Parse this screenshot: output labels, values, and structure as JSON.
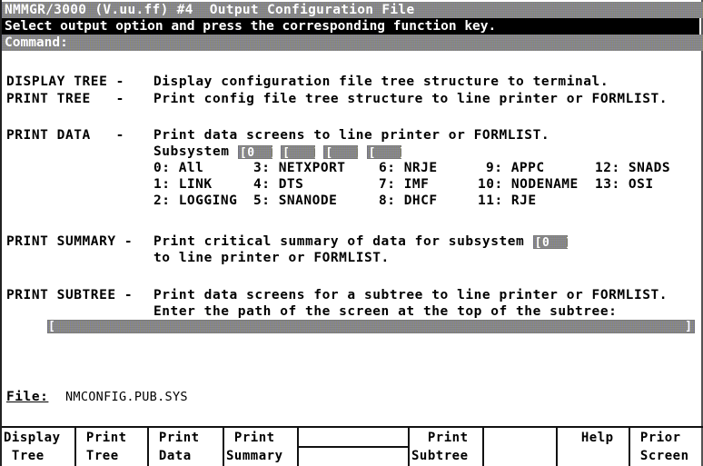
{
  "header": {
    "title": "NMMGR/3000 (V.uu.ff) #4  Output Configuration File",
    "message": "Select output option and press the corresponding function key.",
    "command_label": "Command:",
    "command_value": ""
  },
  "options": [
    {
      "label": "DISPLAY TREE -",
      "lines": [
        "Display configuration file tree structure to terminal."
      ]
    },
    {
      "label": "PRINT TREE   -",
      "lines": [
        "Print config file tree structure to line printer or FORMLIST."
      ]
    },
    {
      "label": "PRINT DATA   -",
      "lines": [
        "Print data screens to line printer or FORMLIST."
      ]
    },
    {
      "label": "PRINT SUMMARY -",
      "lines": [
        "Print critical summary of data for subsystem",
        "to line printer or FORMLIST."
      ]
    },
    {
      "label": "PRINT SUBTREE -",
      "lines": [
        "Print data screens for a subtree to line printer or FORMLIST.",
        "Enter the path of the screen at the top of the subtree:"
      ]
    }
  ],
  "print_data": {
    "subsystem_label": "Subsystem",
    "subsystem_fields": [
      "0",
      "",
      "",
      ""
    ],
    "subsystems": [
      [
        "0: All",
        "3: NETXPORT",
        "6: NRJE",
        "9: APPC",
        "12: SNADS"
      ],
      [
        "1: LINK",
        "4: DTS",
        "7: IMF",
        "10: NODENAME",
        "13: OSI"
      ],
      [
        "2: LOGGING",
        "5: SNANODE",
        "8: DHCF",
        "11: RJE",
        ""
      ]
    ]
  },
  "print_summary": {
    "subsystem_field": "0"
  },
  "print_subtree": {
    "path_value": ""
  },
  "file": {
    "label": "File:",
    "value": "NMCONFIG.PUB.SYS"
  },
  "function_keys": [
    {
      "line1": "Display",
      "line2": " Tree"
    },
    {
      "line1": " Print",
      "line2": " Tree"
    },
    {
      "line1": " Print",
      "line2": " Data"
    },
    {
      "line1": " Print",
      "line2": "Summary"
    },
    {
      "line1": "",
      "line2": ""
    },
    {
      "line1": "  Print",
      "line2": "Subtree"
    },
    {
      "line1": "",
      "line2": ""
    },
    {
      "line1": "  Help",
      "line2": ""
    },
    {
      "line1": " Prior",
      "line2": " Screen"
    }
  ],
  "colors": {
    "field_bg": "#8a8a8c",
    "message_bg": "#000000",
    "text": "#000000"
  }
}
